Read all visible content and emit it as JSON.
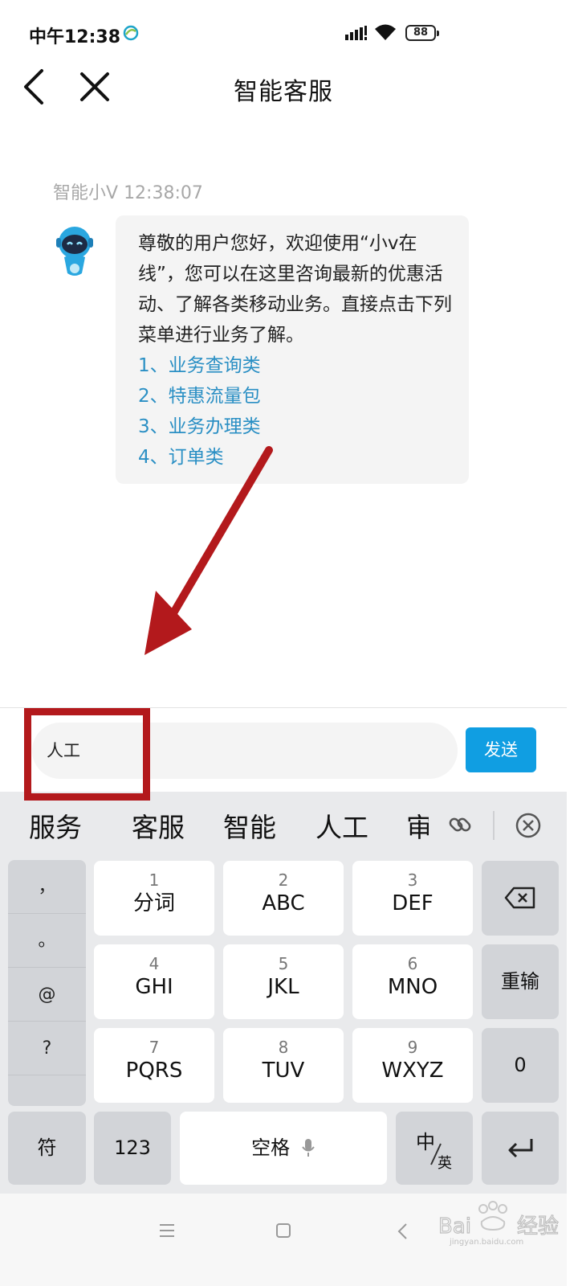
{
  "status_bar": {
    "time": "中午12:38",
    "battery": "88"
  },
  "header": {
    "title": "智能客服"
  },
  "chat": {
    "sender": "智能小V",
    "timestamp": "12:38:07",
    "welcome_text": "尊敬的用户您好，欢迎使用“小v在线”，您可以在这里咨询最新的优惠活动、了解各类移动业务。直接点击下列菜单进行业务了解。",
    "menu_items": [
      "1、业务查询类",
      "2、特惠流量包",
      "3、业务办理类",
      "4、订单类"
    ]
  },
  "input": {
    "value": "人工",
    "send_label": "发送"
  },
  "keyboard": {
    "candidates": [
      "服务",
      "客服",
      "智能",
      "人工"
    ],
    "candidate_partial": "审",
    "punctuation": [
      "，",
      "。",
      "@",
      "?"
    ],
    "keys": [
      {
        "num": "1",
        "label": "分词"
      },
      {
        "num": "2",
        "label": "ABC"
      },
      {
        "num": "3",
        "label": "DEF"
      },
      {
        "num": "4",
        "label": "GHI"
      },
      {
        "num": "5",
        "label": "JKL"
      },
      {
        "num": "6",
        "label": "MNO"
      },
      {
        "num": "7",
        "label": "PQRS"
      },
      {
        "num": "8",
        "label": "TUV"
      },
      {
        "num": "9",
        "label": "WXYZ"
      }
    ],
    "reinput": "重输",
    "zero": "0",
    "symbols": "符",
    "numbers": "123",
    "space": "空格",
    "lang_top": "中",
    "lang_bottom": "英"
  },
  "watermark": {
    "text": "Bai经验",
    "url": "jingyan.baidu.com"
  },
  "colors": {
    "link": "#2a8fc4",
    "send_button": "#109ee2",
    "annotation": "#b3191c"
  }
}
